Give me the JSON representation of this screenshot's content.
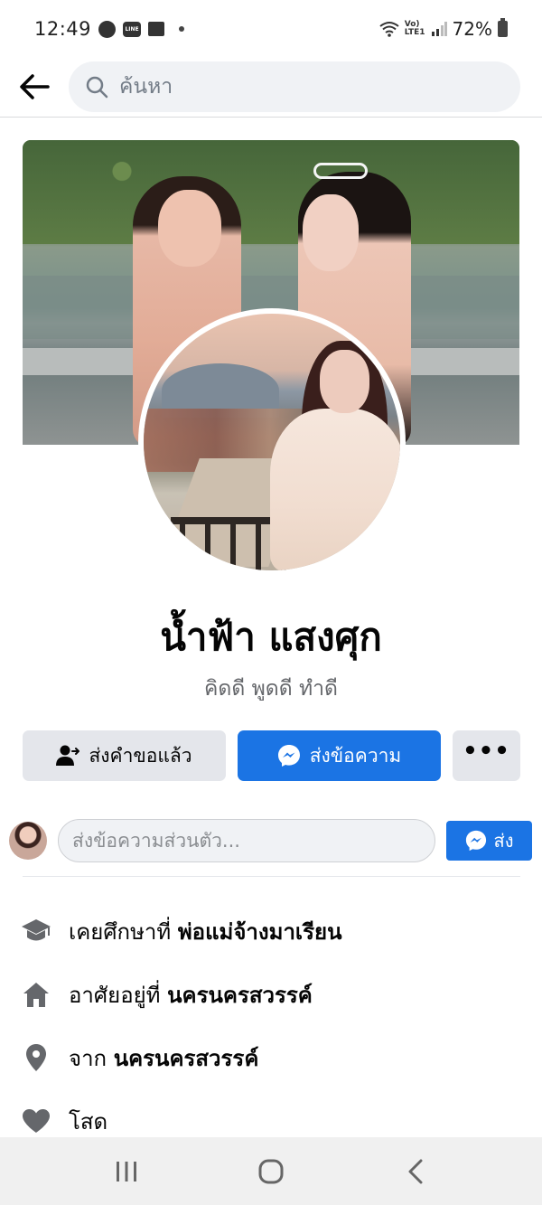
{
  "status_bar": {
    "time": "12:49",
    "volte_label": "Vo)\nLTE1",
    "battery": "72%"
  },
  "search": {
    "placeholder": "ค้นหา"
  },
  "profile": {
    "name": "น้ำฟ้า แสงศุก",
    "bio": "คิดดี พูดดี ทำดี"
  },
  "actions": {
    "request_sent_label": "ส่งคำขอแล้ว",
    "message_label": "ส่งข้อความ",
    "more_label": "•••"
  },
  "message_bar": {
    "placeholder": "ส่งข้อความส่วนตัว...",
    "send_label": "ส่ง"
  },
  "details": [
    {
      "icon": "graduation-cap-icon",
      "prefix": "เคยศึกษาที่ ",
      "value": "พ่อแม่จ้างมาเรียน"
    },
    {
      "icon": "home-icon",
      "prefix": "อาศัยอยู่ที่ ",
      "value": "นครนครสวรรค์"
    },
    {
      "icon": "location-pin-icon",
      "prefix": "จาก ",
      "value": "นครนครสวรรค์"
    },
    {
      "icon": "heart-icon",
      "prefix": "โสด",
      "value": ""
    }
  ],
  "colors": {
    "accent": "#1b74e4",
    "button_gray": "#e4e6eb",
    "text_secondary": "#65676b",
    "icon_gray": "#65676b"
  }
}
